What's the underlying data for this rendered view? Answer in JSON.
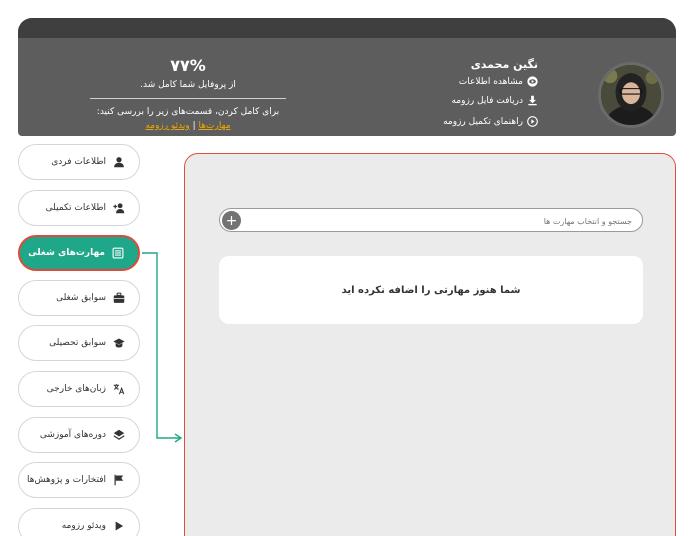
{
  "header": {
    "user_name": "نگین محمدی",
    "links": {
      "view_info": "مشاهده اطلاعات",
      "download_resume": "دریافت فایل رزومه",
      "completion_guide": "راهنمای تکمیل رزومه"
    },
    "progress": {
      "value": "۷۷%",
      "message": "از پروفایل شما کامل شد.",
      "hint": "برای کامل کردن، قسمت‌های زیر را بررسی کنید:",
      "link_skills": "مهارت‌ها",
      "separator": "|",
      "link_video": "ویدئو رزومه"
    }
  },
  "sidebar": {
    "items": [
      {
        "label": "اطلاعات فردی",
        "icon": "user-icon"
      },
      {
        "label": "اطلاعات تکمیلی",
        "icon": "user-plus-icon"
      },
      {
        "label": "مهارت‌های شغلی",
        "icon": "list-icon",
        "active": true
      },
      {
        "label": "سوابق شغلی",
        "icon": "briefcase-icon"
      },
      {
        "label": "سوابق تحصیلی",
        "icon": "graduation-cap-icon"
      },
      {
        "label": "زبان‌های خارجی",
        "icon": "translate-icon"
      },
      {
        "label": "دوره‌های آموزشی",
        "icon": "layers-icon"
      },
      {
        "label": "افتخارات و پژوهش‌ها",
        "icon": "flag-icon"
      },
      {
        "label": "ویدئو رزومه",
        "icon": "play-icon"
      }
    ]
  },
  "main": {
    "search_placeholder": "جستجو و انتخاب مهارت ها",
    "add_label": "+",
    "empty_message": "شما هنوز مهارتی را اضافه نکرده اید"
  },
  "colors": {
    "header_bg": "#5d5d5d",
    "accent_green": "#1fa78a",
    "highlight_red": "#e04a3a",
    "link_orange": "#f0a500",
    "panel_bg": "#ebebeb"
  }
}
